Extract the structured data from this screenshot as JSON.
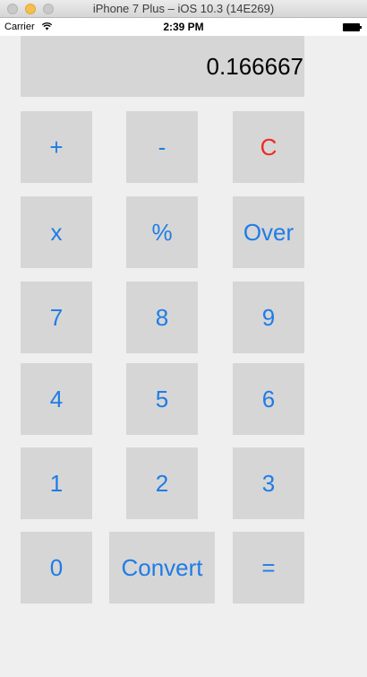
{
  "window": {
    "title": "iPhone 7 Plus – iOS 10.3 (14E269)"
  },
  "status_bar": {
    "carrier": "Carrier",
    "time": "2:39 PM",
    "icons": [
      "wifi-icon",
      "battery-icon"
    ]
  },
  "calculator": {
    "display_value": "0.166667",
    "keys": {
      "plus": "+",
      "minus": "-",
      "clear": "C",
      "multiply": "x",
      "percent": "%",
      "over": "Over",
      "seven": "7",
      "eight": "8",
      "nine": "9",
      "four": "4",
      "five": "5",
      "six": "6",
      "one": "1",
      "two": "2",
      "three": "3",
      "zero": "0",
      "convert": "Convert",
      "equals": "="
    }
  },
  "colors": {
    "key_text": "#1f7ce6",
    "clear_text": "#f02a1e",
    "key_background": "#d6d6d6",
    "screen_background": "#efefef"
  }
}
